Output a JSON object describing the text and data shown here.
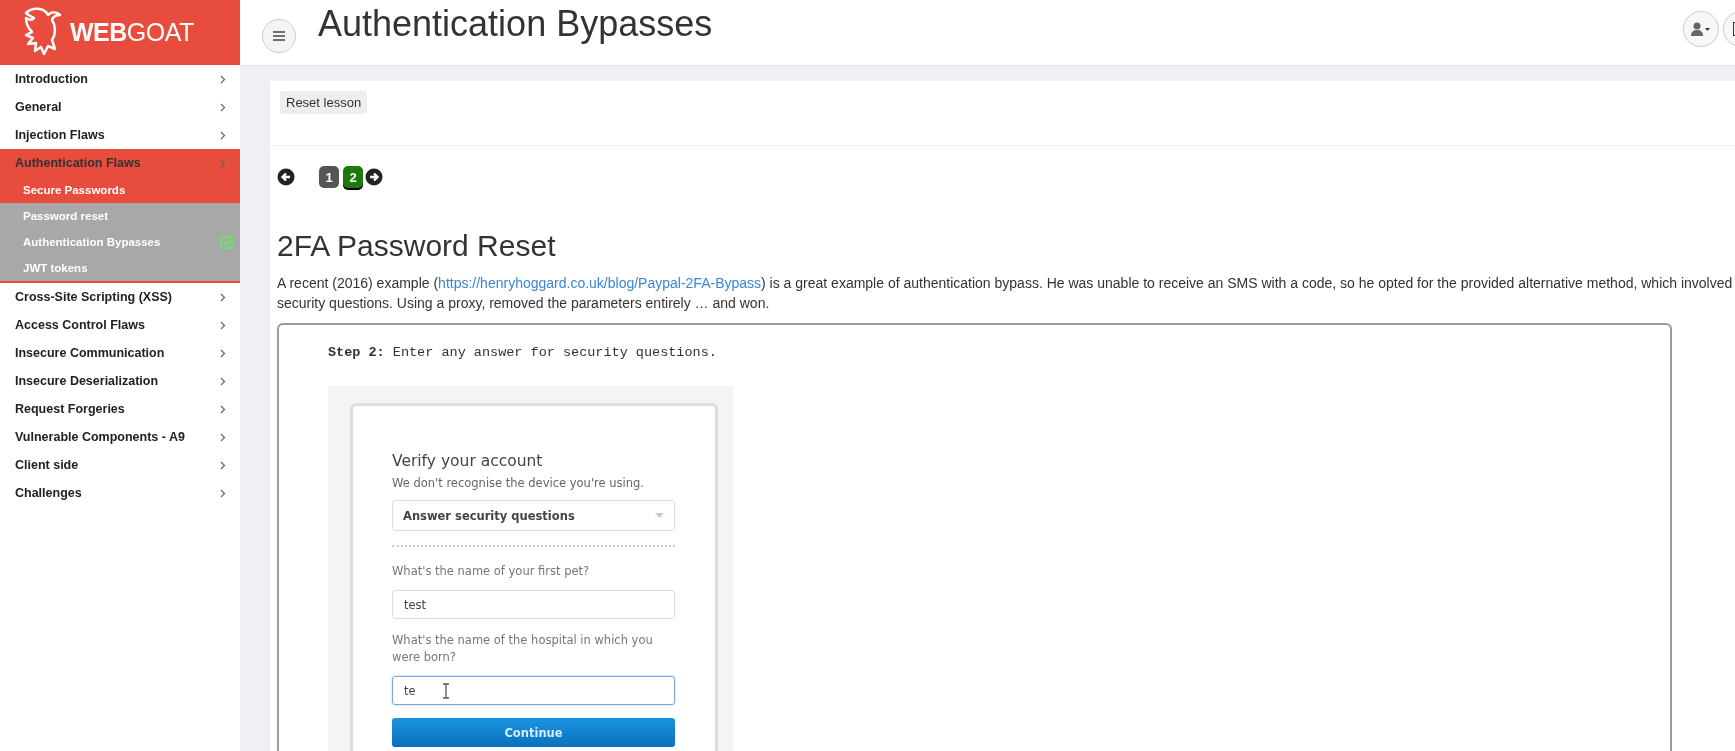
{
  "logo": {
    "bold": "WEB",
    "light": "GOAT"
  },
  "sidebar": {
    "items": [
      {
        "label": "Introduction",
        "expanded": false
      },
      {
        "label": "General",
        "expanded": false
      },
      {
        "label": "Injection Flaws",
        "expanded": false
      },
      {
        "label": "Authentication Flaws",
        "expanded": true,
        "children": [
          {
            "label": "Secure Passwords",
            "highlighted": true,
            "completed": false
          },
          {
            "label": "Password reset",
            "highlighted": false,
            "completed": false
          },
          {
            "label": "Authentication Bypasses",
            "highlighted": false,
            "completed": true
          },
          {
            "label": "JWT tokens",
            "highlighted": false,
            "completed": false
          }
        ]
      },
      {
        "label": "Cross-Site Scripting (XSS)",
        "expanded": false
      },
      {
        "label": "Access Control Flaws",
        "expanded": false
      },
      {
        "label": "Insecure Communication",
        "expanded": false
      },
      {
        "label": "Insecure Deserialization",
        "expanded": false
      },
      {
        "label": "Request Forgeries",
        "expanded": false
      },
      {
        "label": "Vulnerable Components - A9",
        "expanded": false
      },
      {
        "label": "Client side",
        "expanded": false
      },
      {
        "label": "Challenges",
        "expanded": false
      }
    ]
  },
  "header": {
    "title": "Authentication Bypasses"
  },
  "lesson": {
    "reset_button": "Reset lesson",
    "pages": [
      {
        "label": "1",
        "selected": false
      },
      {
        "label": "2",
        "selected": true
      }
    ],
    "heading": "2FA Password Reset",
    "paragraph_before": "A recent (2016) example (",
    "paragraph_link": "https://henryhoggard.co.uk/blog/Paypal-2FA-Bypass",
    "paragraph_after": ") is a great example of authentication bypass. He was unable to receive an SMS with a code, so he opted for the provided alternative method, which involved security questions. Using a proxy, removed the parameters entirely … and won.",
    "example": {
      "step": "**Step 2:** Enter any answer for security questions.",
      "form": {
        "title": "Verify your account",
        "subtitle": "We don't recognise the device you're using.",
        "method": "Answer security questions",
        "questions": [
          {
            "label": "What's the name of your first pet?",
            "value": "test",
            "focused": false
          },
          {
            "label": "What's the name of the hospital in which you were born?",
            "value": "te",
            "focused": true
          }
        ],
        "button": "Continue"
      }
    }
  }
}
